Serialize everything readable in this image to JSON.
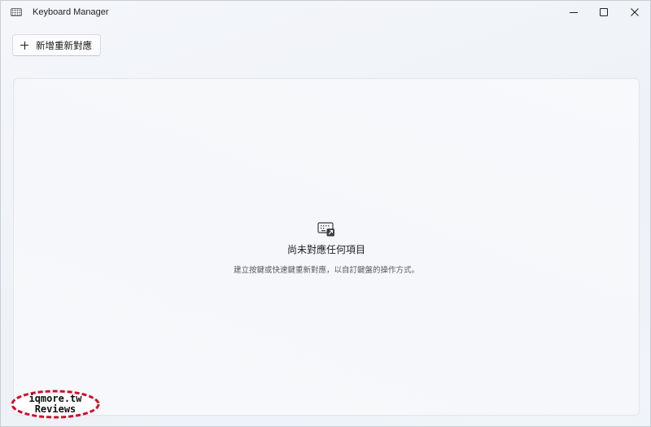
{
  "window": {
    "title": "Keyboard Manager",
    "controls": {
      "minimize": "minimize-icon",
      "maximize": "maximize-icon",
      "close": "close-icon"
    }
  },
  "toolbar": {
    "add_label": "新增重新對應",
    "add_icon": "plus-icon"
  },
  "empty_state": {
    "icon": "keyboard-remap-icon",
    "title": "尚未對應任何項目",
    "description": "建立按鍵或快速鍵重新對應，以自訂鍵盤的操作方式。"
  },
  "watermark": {
    "line1": "iqmore.tw",
    "line2": "Reviews",
    "color": "#d0102a"
  },
  "colors": {
    "background": "#f3f5f9",
    "card_border": "#e1e4e9",
    "text": "#1e1e1e"
  }
}
